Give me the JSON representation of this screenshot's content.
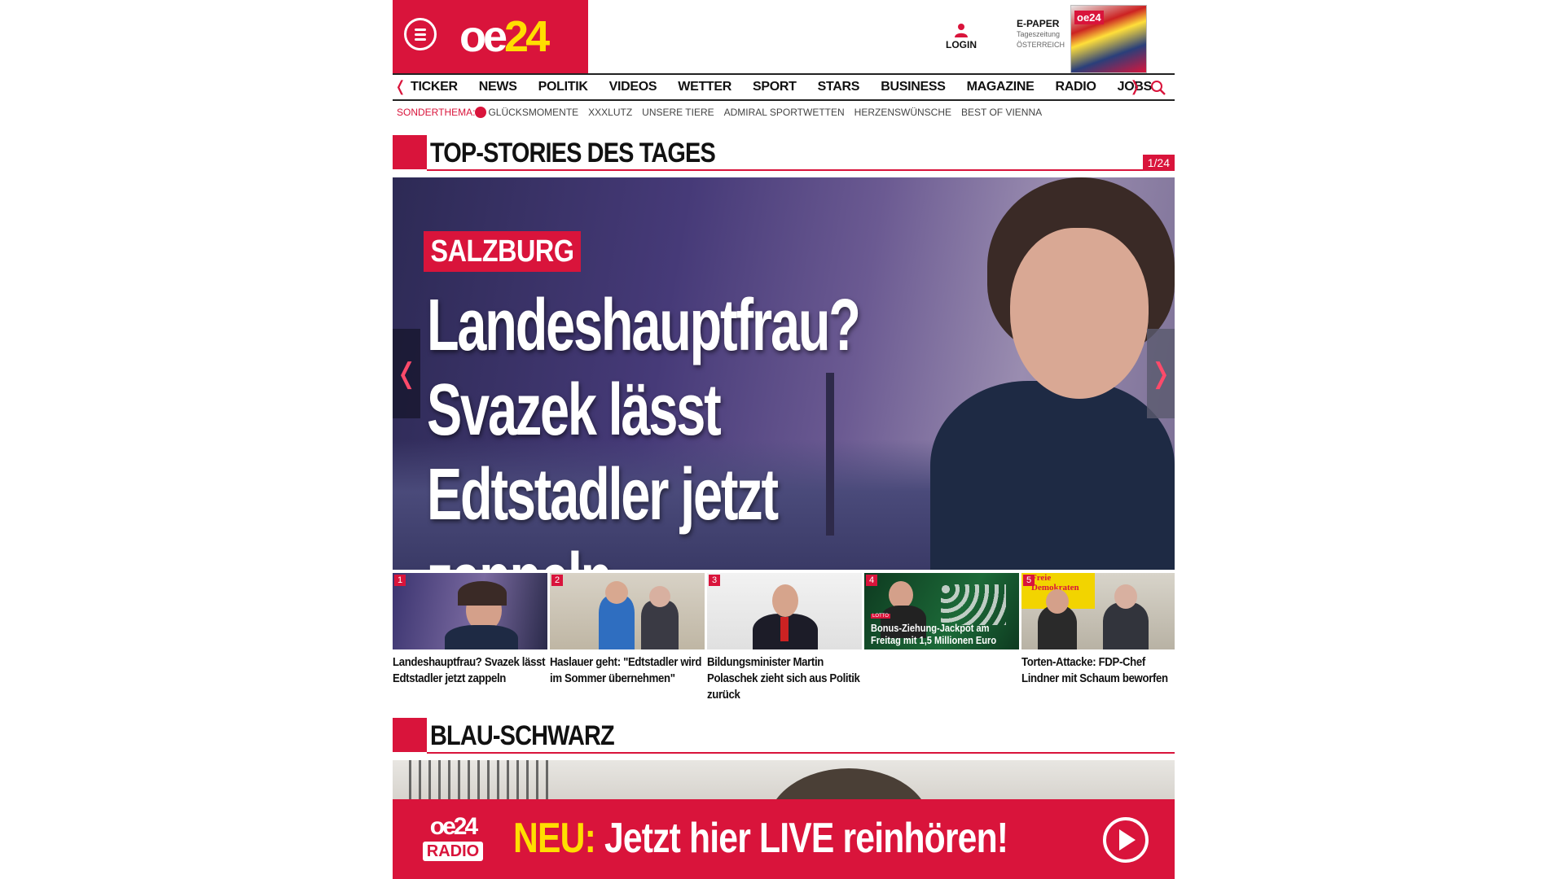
{
  "header": {
    "logo_oe": "oe",
    "logo_24": "24",
    "login_label": "LOGIN",
    "epaper_title": "E-PAPER",
    "epaper_sub1": "Tageszeitung",
    "epaper_sub2": "ÖSTERREICH",
    "epaper_cover_logo": "oe24"
  },
  "nav": {
    "items": [
      "TICKER",
      "NEWS",
      "POLITIK",
      "VIDEOS",
      "WETTER",
      "SPORT",
      "STARS",
      "BUSINESS",
      "MAGAZINE",
      "RADIO",
      "JOBS"
    ]
  },
  "subnav": {
    "label": "SONDERTHEMA:",
    "items": [
      "GLÜCKSMOMENTE",
      "XXXLUTZ",
      "UNSERE TIERE",
      "ADMIRAL SPORTWETTEN",
      "HERZENSWÜNSCHE",
      "BEST OF VIENNA"
    ]
  },
  "top_stories": {
    "title": "TOP-STORIES DES TAGES",
    "counter": "1/24",
    "hero": {
      "tag": "SALZBURG",
      "headline_line1": "Landeshauptfrau?",
      "headline_line2": "Svazek lässt",
      "headline_line3": "Edtstadler jetzt zappeln"
    },
    "thumbs": [
      {
        "num": "1",
        "caption": "Landeshauptfrau? Svazek lässt Edtstadler jetzt zappeln"
      },
      {
        "num": "2",
        "caption": "Haslauer geht: \"Edtstadler wird im Sommer übernehmen\""
      },
      {
        "num": "3",
        "caption": "Bildungsminister Martin Polaschek zieht sich aus Politik zurück"
      },
      {
        "num": "4",
        "caption": "",
        "overlay": "Bonus-Ziehung-Jackpot am Freitag mit 1,5 Millionen Euro",
        "badge": "LOTTO"
      },
      {
        "num": "5",
        "caption": "Torten-Attacke: FDP-Chef Lindner mit Schaum beworfen",
        "overlay_sign": "Freie Demokraten"
      }
    ]
  },
  "section2": {
    "title": "BLAU-SCHWARZ"
  },
  "banner": {
    "radio_logo": "oe24",
    "radio_label": "RADIO",
    "neu": "NEU:",
    "text": "Jetzt hier LIVE reinhören!"
  },
  "colors": {
    "brand_red": "#d9143b",
    "brand_yellow": "#ffde00"
  },
  "icons": [
    "menu-icon",
    "user-icon",
    "search-icon",
    "chevron-left-icon",
    "chevron-right-icon",
    "play-icon"
  ]
}
